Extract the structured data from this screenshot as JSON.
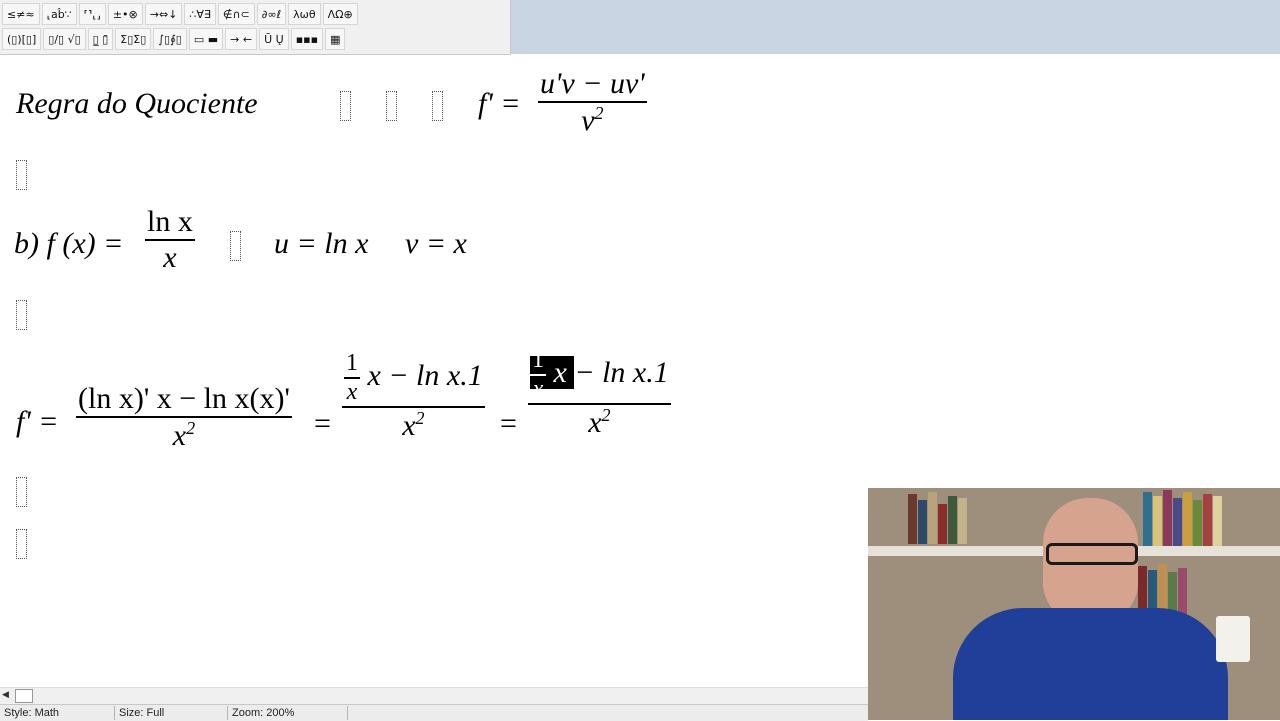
{
  "toolbar": {
    "row1": [
      "≤≠≈",
      "⸤ab̂∵",
      "⸢⸣⸤⸥",
      "±•⊗",
      "→⇔↓",
      "∴∀∃",
      "∉∩⊂",
      "∂∞ℓ",
      "λωθ",
      "ΛΩ⊕"
    ],
    "row2": [
      "(▯)[▯]",
      "▯/▯ √▯",
      "▯̲ ▯̄",
      "Σ▯Σ▯",
      "∫▯∮▯",
      "▭ ▬",
      "→ ←",
      "Ū Ų",
      "▪▪▪",
      "▦"
    ]
  },
  "equations": {
    "line1": {
      "label": "Regra  do  Quociente",
      "lhs": "f' =",
      "num": "u'v − uv'",
      "den_base": "v",
      "den_exp": "2"
    },
    "line2": {
      "prefix": "b) f (x) =",
      "num": "ln x",
      "den": "x",
      "u_def": "u = ln x",
      "v_def": "v = x"
    },
    "line3": {
      "lhs": "f' =",
      "frac1_num": "(ln x)' x − ln x(x)'",
      "den_base": "x",
      "den_exp": "2",
      "eq": "=",
      "frac2_small_num": "1",
      "frac2_small_den": "x",
      "frac2_rest": "x − ln x.1",
      "frac3_sel_num": "1",
      "frac3_sel_den": "x",
      "frac3_sel_x": "x",
      "frac3_rest": "− ln x.1"
    }
  },
  "status": {
    "style": "Style: Math",
    "size": "Size: Full",
    "zoom": "Zoom: 200%"
  },
  "colors": {
    "toolbar_bg": "#f0f0f0",
    "toolbar_ext": "#c9d5e3",
    "selection": "#000000",
    "shirt": "#1f3f99"
  }
}
